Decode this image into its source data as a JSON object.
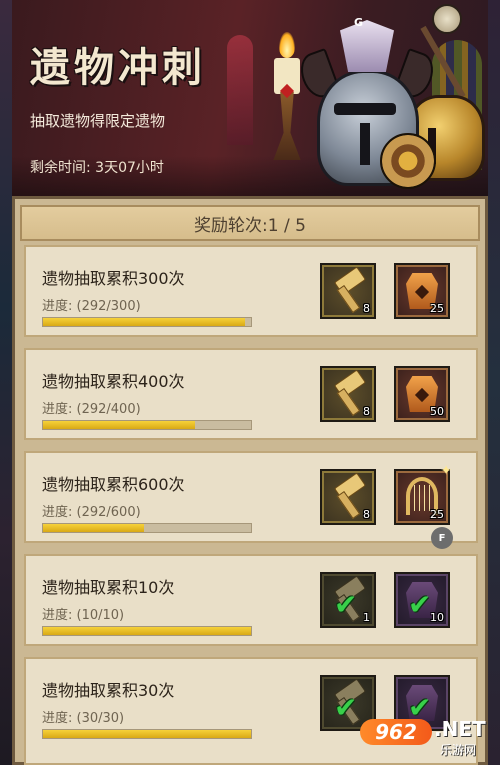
{
  "event": {
    "title": "遗物冲刺",
    "subtitle": "抽取遗物得限定遗物",
    "time_remaining": "剩余时间: 3天07小时",
    "corner_mark": "G"
  },
  "rewards_header": {
    "round_label": "奖励轮次:1 / 5"
  },
  "tasks": [
    {
      "title": "遗物抽取累积300次",
      "progress_text": "进度: (292/300)",
      "progress_fraction": 0.973,
      "rewards": [
        {
          "icon": "hammer-icon",
          "count": "8",
          "claimed": false
        },
        {
          "icon": "armor-icon",
          "count": "25",
          "claimed": false
        }
      ]
    },
    {
      "title": "遗物抽取累积400次",
      "progress_text": "进度: (292/400)",
      "progress_fraction": 0.73,
      "rewards": [
        {
          "icon": "hammer-icon",
          "count": "8",
          "claimed": false
        },
        {
          "icon": "armor-icon",
          "count": "50",
          "claimed": false
        }
      ]
    },
    {
      "title": "遗物抽取累积600次",
      "progress_text": "进度: (292/600)",
      "progress_fraction": 0.487,
      "rewards": [
        {
          "icon": "hammer-icon",
          "count": "8",
          "claimed": false
        },
        {
          "icon": "harp-icon",
          "count": "25",
          "claimed": false
        }
      ]
    },
    {
      "title": "遗物抽取累积10次",
      "progress_text": "进度: (10/10)",
      "progress_fraction": 1.0,
      "rewards": [
        {
          "icon": "hammer-icon",
          "count": "1",
          "claimed": true
        },
        {
          "icon": "armor-icon",
          "count": "10",
          "claimed": true
        }
      ]
    },
    {
      "title": "遗物抽取累积30次",
      "progress_text": "进度: (30/30)",
      "progress_fraction": 1.0,
      "rewards": [
        {
          "icon": "hammer-icon",
          "count": "",
          "claimed": true
        },
        {
          "icon": "armor-icon",
          "count": "",
          "claimed": true
        }
      ]
    }
  ],
  "badge_f": "F",
  "watermark": {
    "logo": "962",
    "net": ".NET",
    "site": "乐游网"
  },
  "colors": {
    "progress_fill": "#f0c82a",
    "check": "#38d04a",
    "panel": "#cbb893",
    "card": "#e9dfc8"
  }
}
